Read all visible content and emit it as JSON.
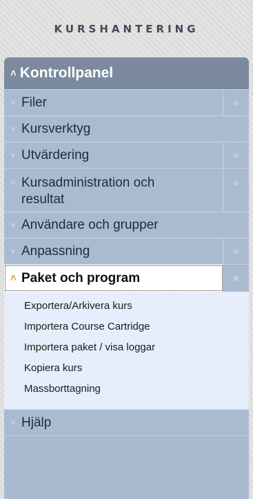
{
  "header": {
    "title": "KURSHANTERING"
  },
  "panel": {
    "title": "Kontrollpanel",
    "expand_glyph": "˄"
  },
  "glyphs": {
    "collapsed": "»",
    "side_arrow": "»",
    "expand_down": "˅",
    "expand_up": "˄"
  },
  "menu": [
    {
      "label": "Filer",
      "has_side": true
    },
    {
      "label": "Kursverktyg",
      "has_side": false
    },
    {
      "label": "Utvärdering",
      "has_side": true
    },
    {
      "label": "Kursadministration och resultat",
      "has_side": true
    },
    {
      "label": "Användare och grupper",
      "has_side": false
    },
    {
      "label": "Anpassning",
      "has_side": true
    },
    {
      "label": "Paket och program",
      "has_side": true,
      "expanded": true
    },
    {
      "label": "Hjälp",
      "has_side": false
    }
  ],
  "submenu": [
    "Exportera/Arkivera kurs",
    "Importera Course Cartridge",
    "Importera paket / visa loggar",
    "Kopiera kurs",
    "Massborttagning"
  ],
  "colors": {
    "panel_header": "#7b8a9e",
    "row_bg": "#aabbd1",
    "submenu_bg": "#e6eefb",
    "active_chevron": "#e0a030"
  }
}
